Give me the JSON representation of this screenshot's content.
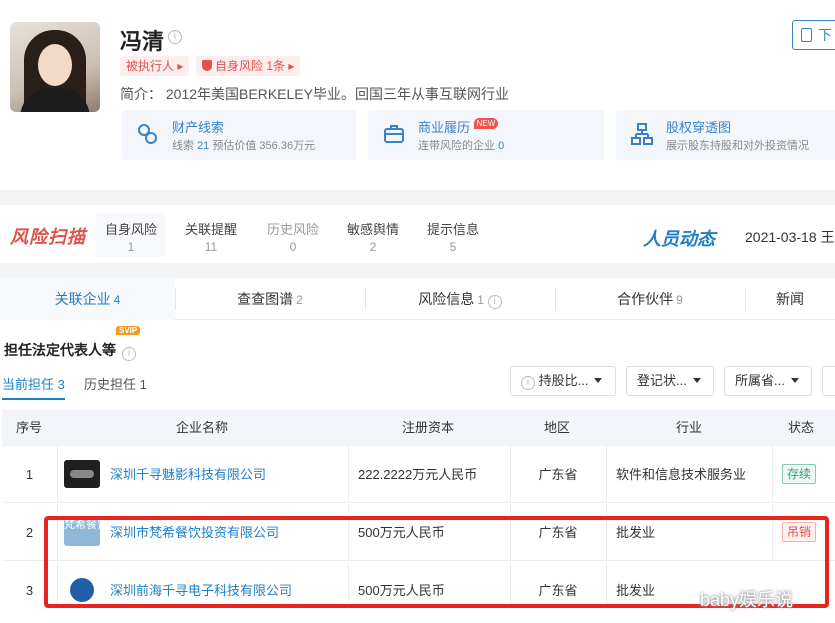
{
  "profile": {
    "name": "冯清",
    "tags": [
      "被执行人 ▸",
      "自身风险 1条 ▸"
    ],
    "intro": "简介：  2012年美国BERKELEY毕业。回国三年从事互联网行业",
    "download_label": "下",
    "features": [
      {
        "title": "财产线索",
        "sub_prefix": "线索 ",
        "sub_highlight": "21",
        "sub_suffix": "  预估价值 356.36万元",
        "icon": "coins-icon"
      },
      {
        "title": "商业履历",
        "badge": "NEW",
        "sub_prefix": "连带风险的企业 ",
        "sub_highlight": "0",
        "sub_suffix": "",
        "icon": "briefcase-icon"
      },
      {
        "title": "股权穿透图",
        "sub_prefix": "展示股东持股和对外投资情况",
        "sub_highlight": "",
        "sub_suffix": "",
        "icon": "org-chart-icon"
      }
    ]
  },
  "risk": {
    "logo": "风险扫描",
    "items": [
      {
        "label": "自身风险",
        "count": "1"
      },
      {
        "label": "关联提醒",
        "count": "11"
      },
      {
        "label": "历史风险",
        "count": "0"
      },
      {
        "label": "敏感舆情",
        "count": "2"
      },
      {
        "label": "提示信息",
        "count": "5"
      }
    ],
    "people_logo": "人员动态",
    "people_date": "2021-03-18 王"
  },
  "tabs": [
    {
      "label": "关联企业",
      "count": "4"
    },
    {
      "label": "查查图谱",
      "count": "2"
    },
    {
      "label": "风险信息",
      "count": "1"
    },
    {
      "label": "合作伙伴",
      "count": "9"
    },
    {
      "label": "新闻",
      "count": ""
    }
  ],
  "section": {
    "title": "担任法定代表人等",
    "vip": "SVIP",
    "subtab_current": "当前担任 3",
    "subtab_history": "历史担任 1",
    "filters": [
      "持股比...",
      "登记状...",
      "所属省..."
    ]
  },
  "table": {
    "headers": [
      "序号",
      "企业名称",
      "注册资本",
      "地区",
      "行业",
      "状态"
    ],
    "rows": [
      {
        "idx": "1",
        "name": "深圳千寻魅影科技有限公司",
        "capital": "222.2222万元人民币",
        "area": "广东省",
        "industry": "软件和信息技术服务业",
        "status": "存续"
      },
      {
        "idx": "2",
        "name": "深圳市梵希餐饮投资有限公司",
        "capital": "500万元人民币",
        "area": "广东省",
        "industry": "批发业",
        "status": "吊销",
        "logo_text": "梵希餐饮"
      },
      {
        "idx": "3",
        "name": "深圳前海千寻电子科技有限公司",
        "capital": "500万元人民币",
        "area": "广东省",
        "industry": "批发业",
        "status": ""
      }
    ]
  },
  "watermark": "baby娱乐说",
  "colors": {
    "accent": "#1f7fc4",
    "risk_red": "#e0524a",
    "highlight_red": "#e8251c"
  }
}
